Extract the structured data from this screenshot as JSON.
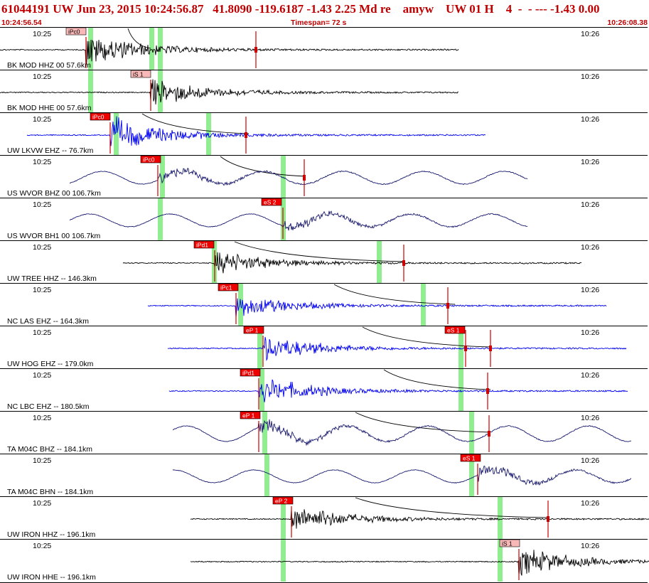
{
  "header": {
    "title": "61044191 UW Jun 23, 2015 10:24:56.87   41.8090 -119.6187 -1.43 2.25 Md re    amyw    UW 01 H    4  -  - --- -1.43 0.00",
    "start_time": "10:24:56.54",
    "timespan": "Timespan=  72 s",
    "end_time": "10:26:08.38"
  },
  "time_ticks": {
    "left": "10:25",
    "right": "10:26"
  },
  "colors": {
    "title": "#cc0000",
    "trace_black": "#000000",
    "trace_blue": "#0000ee",
    "trace_navy": "#1a1a6e",
    "pick_flag": "#ee0000",
    "pick_flag_light": "#f8b8b8",
    "highlight": "#90ee90",
    "pick_line": "#cc0000"
  },
  "channels": [
    {
      "label": "BK MOD HHZ 00 57.6km",
      "color": "black",
      "pick": "iPc0",
      "pick_style": "light"
    },
    {
      "label": "BK MOD HHE 00 57.6km",
      "color": "black",
      "pick": "iS 1",
      "pick_style": "light"
    },
    {
      "label": "UW LKVW EHZ -- 76.7km",
      "color": "blue",
      "pick": "iPc0",
      "pick_style": "solid"
    },
    {
      "label": "US WVOR BHZ 00 106.7km",
      "color": "navy",
      "pick": "iPc0",
      "pick_style": "solid"
    },
    {
      "label": "US WVOR BH1 00 106.7km",
      "color": "navy",
      "pick": "eS 2",
      "pick_style": "solid"
    },
    {
      "label": "UW TREE HHZ -- 146.3km",
      "color": "black",
      "pick": "iPd1",
      "pick_style": "solid"
    },
    {
      "label": "NC LAS EHZ -- 164.3km",
      "color": "blue",
      "pick": "iPc1",
      "pick_style": "solid"
    },
    {
      "label": "UW HOG EHZ -- 179.0km",
      "color": "blue",
      "pick": "eP 1",
      "pick2": "eS 1",
      "pick_style": "solid"
    },
    {
      "label": "NC LBC EHZ -- 180.5km",
      "color": "blue",
      "pick": "iPd1",
      "pick_style": "solid"
    },
    {
      "label": "TA M04C BHZ -- 184.1km",
      "color": "navy",
      "pick": "eP 1",
      "pick_style": "solid"
    },
    {
      "label": "TA M04C BHN -- 184.1km",
      "color": "navy",
      "pick": "eS 1",
      "pick_style": "solid"
    },
    {
      "label": "UW IRON HHZ -- 196.1km",
      "color": "black",
      "pick": "eP 2",
      "pick_style": "solid"
    },
    {
      "label": "UW IRON HHE -- 196.1km",
      "color": "black",
      "pick": "iS 1",
      "pick_style": "light"
    }
  ]
}
